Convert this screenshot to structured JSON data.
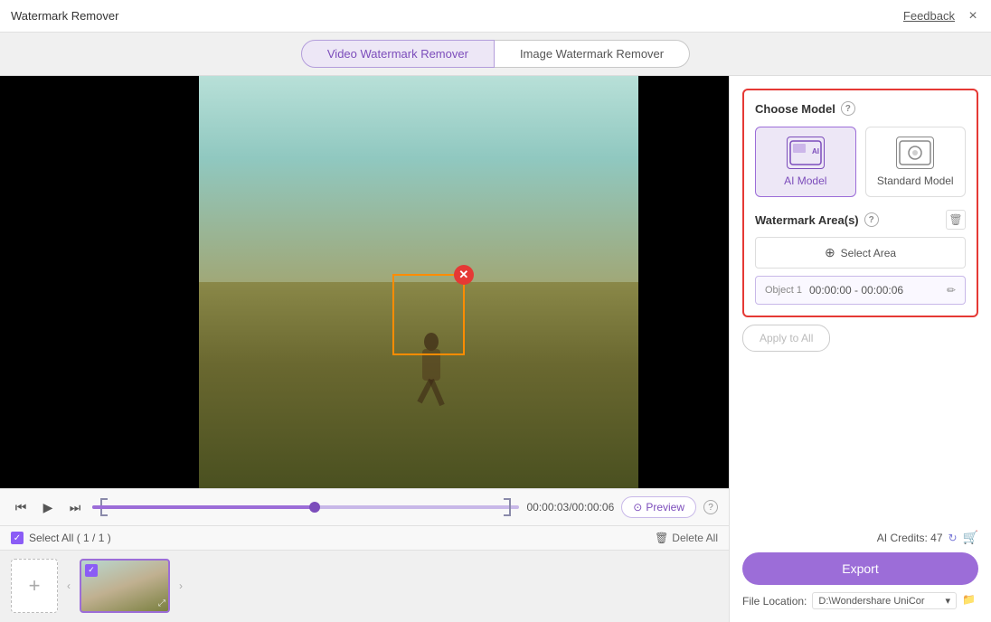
{
  "titleBar": {
    "title": "Watermark Remover",
    "feedback": "Feedback",
    "closeLabel": "×"
  },
  "tabs": {
    "items": [
      {
        "id": "video",
        "label": "Video Watermark Remover",
        "active": true
      },
      {
        "id": "image",
        "label": "Image Watermark Remover",
        "active": false
      }
    ]
  },
  "video": {
    "timeDisplay": "00:00:03/00:00:06",
    "previewLabel": "Preview"
  },
  "timeline": {
    "progress": "52%"
  },
  "bottomStrip": {
    "selectAllLabel": "Select All ( 1 / 1 )",
    "deleteAllLabel": "Delete All"
  },
  "rightPanel": {
    "chooseModelTitle": "Choose Model",
    "models": [
      {
        "id": "ai",
        "label": "AI Model",
        "selected": true,
        "iconText": "🤖"
      },
      {
        "id": "standard",
        "label": "Standard Model",
        "selected": false,
        "iconText": "⚙"
      }
    ],
    "watermarkAreaTitle": "Watermark Area(s)",
    "selectAreaLabel": "Select Area",
    "objectItem": {
      "label": "Object 1",
      "time": "00:00:00 - 00:00:06"
    },
    "applyAllLabel": "Apply to All",
    "creditsLabel": "AI Credits: 47",
    "exportLabel": "Export",
    "fileLocationLabel": "File Location:",
    "fileLocationValue": "D:\\Wondershare UniCor"
  }
}
